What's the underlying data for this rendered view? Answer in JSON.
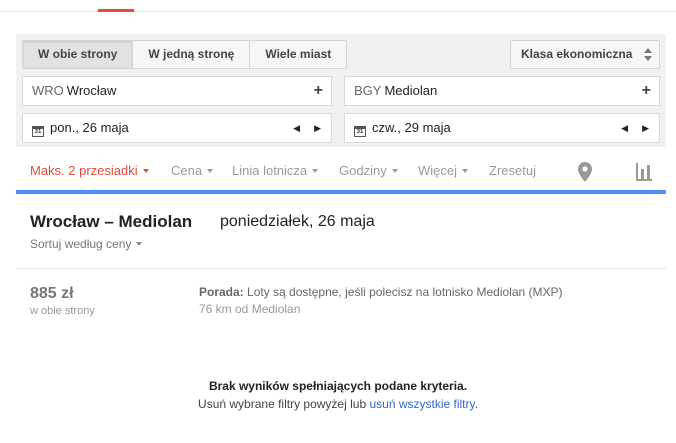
{
  "trip_types": [
    "W obie strony",
    "W jedną stronę",
    "Wiele miast"
  ],
  "cabin_class": "Klasa ekonomiczna",
  "origin": {
    "code": "WRO",
    "name": "Wrocław"
  },
  "destination": {
    "code": "BGY",
    "name": "Mediolan"
  },
  "depart_date": "pon., 26 maja",
  "return_date": "czw., 29 maja",
  "calendar_icon_text": "31",
  "filters": {
    "stops": "Maks. 2 przesiadki",
    "price": "Cena",
    "airline": "Linia lotnicza",
    "hours": "Godziny",
    "more": "Więcej",
    "reset": "Zresetuj"
  },
  "results": {
    "route": "Wrocław – Mediolan",
    "date": "poniedziałek, 26 maja",
    "sort": "Sortuj według ceny",
    "price": "885 zł",
    "price_note": "w obie strony",
    "tip_label": "Porada:",
    "tip_text": "Loty są dostępne, jeśli polecisz na lotnisko Mediolan (MXP)",
    "tip_distance": "76 km od Mediolan"
  },
  "no_results": {
    "title": "Brak wyników spełniających podane kryteria.",
    "message_before": "Usuń wybrane filtry powyżej lub",
    "link": "usuń wszystkie filtry",
    "message_after": "."
  },
  "colors": {
    "accent_red": "#dd4b39",
    "accent_blue": "#4d90fe",
    "link": "#3366cc"
  }
}
